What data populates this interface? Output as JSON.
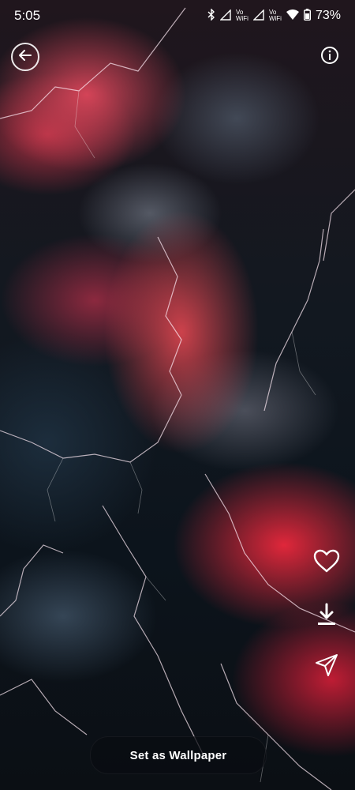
{
  "status_bar": {
    "time": "5:05",
    "vowifi_1": "Vo\nWiFi",
    "vowifi_2": "Vo\nWiFi",
    "battery": "73%"
  },
  "icons": {
    "back": "back-arrow-icon",
    "info": "info-icon",
    "favorite": "heart-icon",
    "download": "download-icon",
    "share": "send-icon"
  },
  "actions": {
    "set_wallpaper_label": "Set as Wallpaper"
  }
}
